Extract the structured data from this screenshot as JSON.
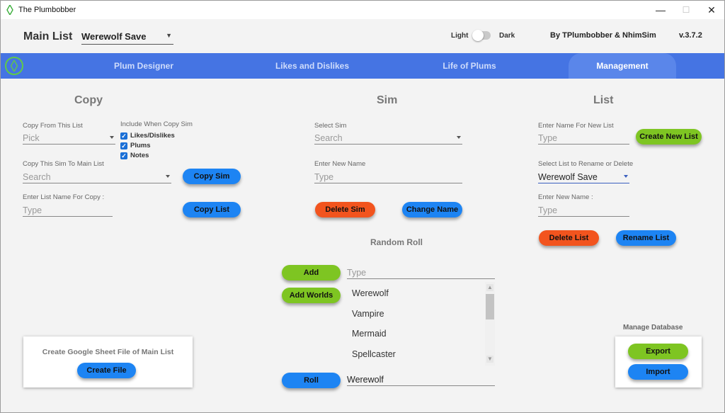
{
  "window": {
    "title": "The Plumbobber",
    "min": "—",
    "max": "☐",
    "close": "✕"
  },
  "header": {
    "main_list_label": "Main List",
    "main_list_value": "Werewolf Save",
    "light": "Light",
    "dark": "Dark",
    "byline": "By TPlumbobber & NhimSim",
    "version": "v.3.7.2"
  },
  "nav": {
    "tabs": [
      {
        "label": "Plum Designer"
      },
      {
        "label": "Likes and Dislikes"
      },
      {
        "label": "Life of Plums"
      },
      {
        "label": "Management"
      }
    ]
  },
  "copy": {
    "heading": "Copy",
    "from_label": "Copy From This List",
    "from_placeholder": "Pick",
    "include_label": "Include When Copy Sim",
    "include_opts": [
      "Likes/Dislikes",
      "Plums",
      "Notes"
    ],
    "sim_label": "Copy This Sim To Main List",
    "sim_placeholder": "Search",
    "copy_sim_btn": "Copy Sim",
    "list_name_label": "Enter List Name For Copy :",
    "list_name_placeholder": "Type",
    "copy_list_btn": "Copy List"
  },
  "sim": {
    "heading": "Sim",
    "select_label": "Select Sim",
    "select_placeholder": "Search",
    "new_name_label": "Enter New Name",
    "new_name_placeholder": "Type",
    "delete_btn": "Delete Sim",
    "change_btn": "Change Name"
  },
  "random": {
    "heading": "Random Roll",
    "add_btn": "Add",
    "type_placeholder": "Type",
    "add_worlds_btn": "Add Worlds",
    "items": [
      "Werewolf",
      "Vampire",
      "Mermaid",
      "Spellcaster"
    ],
    "roll_btn": "Roll",
    "roll_result": "Werewolf"
  },
  "list": {
    "heading": "List",
    "new_label": "Enter Name For New List",
    "new_placeholder": "Type",
    "create_btn": "Create New List",
    "rename_label": "Select List to Rename or Delete",
    "rename_value": "Werewolf Save",
    "new_name_label": "Enter New Name :",
    "new_name_placeholder": "Type",
    "delete_btn": "Delete List",
    "rename_btn": "Rename List"
  },
  "google": {
    "label": "Create Google Sheet File of Main List",
    "create_btn": "Create File"
  },
  "database": {
    "label": "Manage Database",
    "export_btn": "Export",
    "import_btn": "Import"
  }
}
